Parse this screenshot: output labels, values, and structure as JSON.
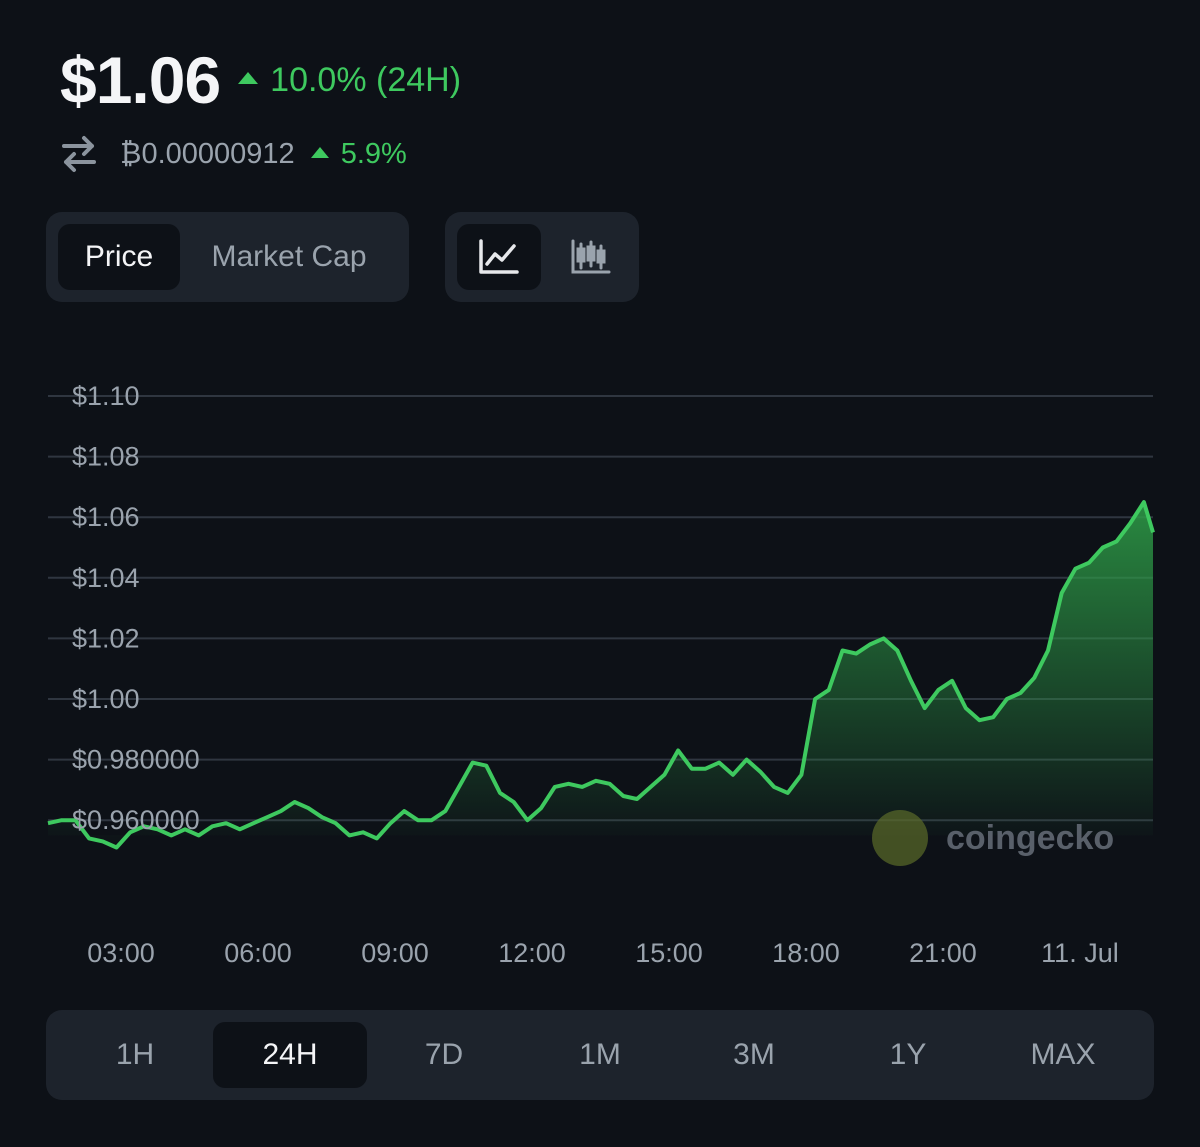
{
  "header": {
    "price": "$1.06",
    "change": "10.0% (24H)",
    "btc_price": "₿0.00000912",
    "btc_change": "5.9%"
  },
  "icons": {
    "swap": "swap-arrows-icon",
    "up": "triangle-up-icon",
    "line_chart": "line-chart-icon",
    "candlestick": "candlestick-chart-icon"
  },
  "tabs": [
    {
      "label": "Price",
      "active": true
    },
    {
      "label": "Market Cap",
      "active": false
    }
  ],
  "chart_view": {
    "selected": "line"
  },
  "colors": {
    "background": "#0d1117",
    "accent_up": "#3ec95f",
    "panel": "#1d232c",
    "muted": "#9aa3ad"
  },
  "watermark": {
    "text": "coingecko"
  },
  "chart_data": {
    "type": "area",
    "title": "",
    "xlabel": "",
    "ylabel": "",
    "ylim": [
      0.95,
      1.1
    ],
    "y_ticks": [
      "$1.10",
      "$1.08",
      "$1.06",
      "$1.04",
      "$1.02",
      "$1.00",
      "$0.980000",
      "$0.960000"
    ],
    "y_tick_values": [
      1.1,
      1.08,
      1.06,
      1.04,
      1.02,
      1.0,
      0.98,
      0.96
    ],
    "x_ticks": [
      "03:00",
      "06:00",
      "09:00",
      "12:00",
      "15:00",
      "18:00",
      "21:00",
      "11. Jul"
    ],
    "x_tick_hours": [
      3,
      6,
      9,
      12,
      15,
      18,
      21,
      24
    ],
    "xlim_hours": [
      1.4,
      25.6
    ],
    "grid": true,
    "series": [
      {
        "x": [
          1.4,
          1.7,
          2.0,
          2.3,
          2.6,
          2.9,
          3.2,
          3.5,
          3.8,
          4.1,
          4.4,
          4.7,
          5.0,
          5.3,
          5.6,
          5.9,
          6.2,
          6.5,
          6.8,
          7.1,
          7.4,
          7.7,
          8.0,
          8.3,
          8.6,
          8.9,
          9.2,
          9.5,
          9.8,
          10.1,
          10.4,
          10.7,
          11.0,
          11.3,
          11.6,
          11.9,
          12.2,
          12.5,
          12.8,
          13.1,
          13.4,
          13.7,
          14.0,
          14.3,
          14.6,
          14.9,
          15.2,
          15.5,
          15.8,
          16.1,
          16.4,
          16.7,
          17.0,
          17.3,
          17.6,
          17.9,
          18.2,
          18.5,
          18.8,
          19.1,
          19.4,
          19.7,
          20.0,
          20.3,
          20.6,
          20.9,
          21.2,
          21.5,
          21.8,
          22.1,
          22.4,
          22.7,
          23.0,
          23.3,
          23.6,
          23.9,
          24.2,
          24.5,
          24.8,
          25.1,
          25.4,
          25.6
        ],
        "values": [
          0.959,
          0.96,
          0.96,
          0.954,
          0.953,
          0.951,
          0.956,
          0.958,
          0.957,
          0.955,
          0.957,
          0.955,
          0.958,
          0.959,
          0.957,
          0.959,
          0.961,
          0.963,
          0.966,
          0.964,
          0.961,
          0.959,
          0.955,
          0.956,
          0.954,
          0.959,
          0.963,
          0.96,
          0.96,
          0.963,
          0.971,
          0.979,
          0.978,
          0.969,
          0.966,
          0.96,
          0.964,
          0.971,
          0.972,
          0.971,
          0.973,
          0.972,
          0.968,
          0.967,
          0.971,
          0.975,
          0.983,
          0.977,
          0.977,
          0.979,
          0.975,
          0.98,
          0.976,
          0.971,
          0.969,
          0.975,
          1.0,
          1.003,
          1.016,
          1.015,
          1.018,
          1.02,
          1.016,
          1.006,
          0.997,
          1.003,
          1.006,
          0.997,
          0.993,
          0.994,
          1.0,
          1.002,
          1.007,
          1.016,
          1.035,
          1.043,
          1.045,
          1.05,
          1.052,
          1.058,
          1.065,
          1.055
        ]
      }
    ]
  },
  "ranges": [
    {
      "label": "1H",
      "active": false
    },
    {
      "label": "24H",
      "active": true
    },
    {
      "label": "7D",
      "active": false
    },
    {
      "label": "1M",
      "active": false
    },
    {
      "label": "3M",
      "active": false
    },
    {
      "label": "1Y",
      "active": false
    },
    {
      "label": "MAX",
      "active": false
    }
  ]
}
